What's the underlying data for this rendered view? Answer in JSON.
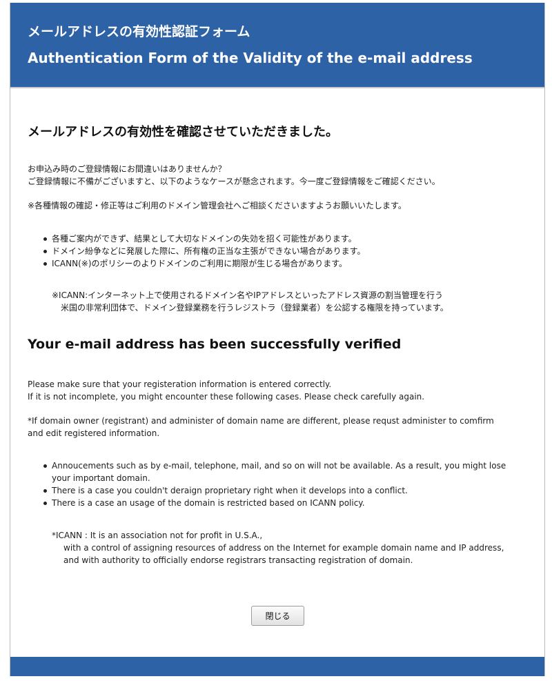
{
  "header": {
    "title_ja": "メールアドレスの有効性認証フォーム",
    "title_en": "Authentication Form of the Validity of the e-mail address"
  },
  "ja": {
    "heading": "メールアドレスの有効性を確認させていただきました。",
    "intro_lines": [
      "お申込み時のご登録情報にお間違いはありませんか？",
      "ご登録情報に不備がございますと、以下のようなケースが懸念されます。今一度ご登録情報をご確認ください。"
    ],
    "notice": "※各種情報の確認・修正等はご利用のドメイン管理会社へご相談くださいますようお願いいたします。",
    "bullets": [
      "各種ご案内ができず、結果として大切なドメインの失効を招く可能性があります。",
      "ドメイン紛争などに発展した際に、所有権の正当な主張ができない場合があります。",
      "ICANN(※)のポリシーのよりドメインのご利用に期限が生じる場合があります。"
    ],
    "footnote_lines": [
      "※ICANN:インターネット上で使用されるドメイン名やIPアドレスといったアドレス資源の割当管理を行う",
      "米国の非常利団体で、ドメイン登録業務を行うレジストラ（登録業者）を公認する権限を持っています。"
    ]
  },
  "en": {
    "heading": "Your e-mail address has been successfully verified",
    "intro_lines": [
      "Please make sure that your registeration information is entered correctly.",
      "If it is not incomplete,  you might encounter these following cases. Please check carefully again."
    ],
    "notice": "*If domain  owner (registrant) and administer of domain name are different, please requst administer to comfirm and edit registered information.",
    "bullets": [
      "Annoucements such as by e-mail, telephone, mail, and so on will not be available. As a result, you might lose your important domain.",
      "There is a case you couldn't deraign proprietary right when it develops into a conflict.",
      "There is a case an usage of the domain is restricted based on ICANN policy."
    ],
    "footnote_lines": [
      "*ICANN : It is an association not for profit in U.S.A.,",
      "with a control of assigning resources of address on the Internet for example domain name and IP address,",
      "and with authority to officially endorse registrars transacting registration of domain."
    ]
  },
  "close_button_label": "閉じる",
  "colors": {
    "header_background": "#2d62a6",
    "header_text": "#ffffff",
    "page_background": "#ffffff"
  }
}
